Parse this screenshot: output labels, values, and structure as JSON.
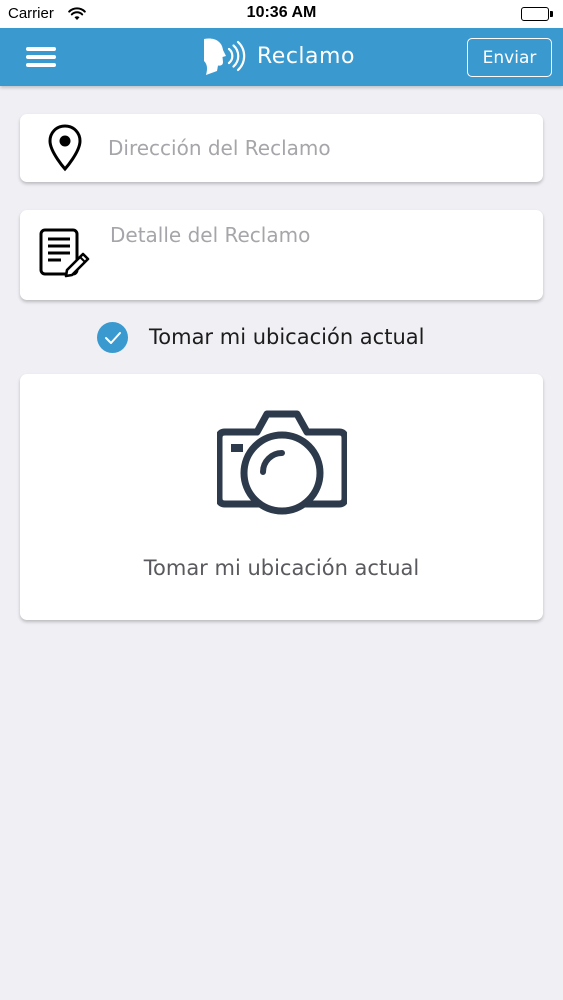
{
  "status_bar": {
    "carrier": "Carrier",
    "time": "10:36 AM"
  },
  "nav": {
    "title": "Reclamo",
    "send_label": "Enviar",
    "menu_icon": "hamburger-menu-icon",
    "logo_icon": "speaking-head-icon"
  },
  "form": {
    "address_placeholder": "Dirección del Reclamo",
    "address_value": "",
    "address_icon": "map-pin-icon",
    "detail_placeholder": "Detalle del Reclamo",
    "detail_value": "",
    "detail_icon": "document-edit-icon",
    "use_location_label": "Tomar mi ubicación actual",
    "use_location_checked": true
  },
  "photo": {
    "label": "Tomar mi ubicación actual",
    "icon": "camera-icon"
  },
  "colors": {
    "accent": "#3a9ad0",
    "background": "#efeff4",
    "icon_dark": "#2d3a4b",
    "placeholder": "#a6a6aa"
  }
}
